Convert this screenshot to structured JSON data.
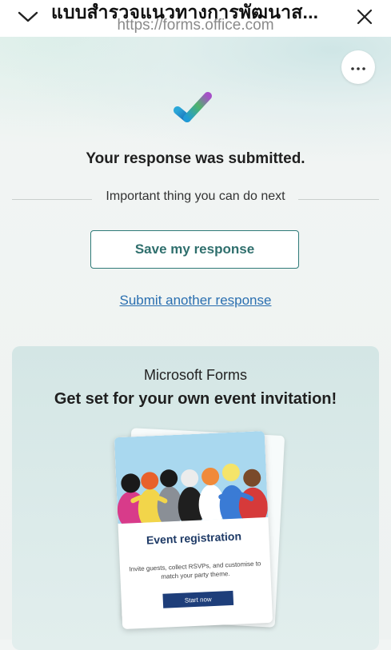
{
  "browser": {
    "title": "แบบสำรวจแนวทางการพัฒนาส...",
    "url": "https://forms.office.com",
    "collapse_icon": "chevron-down-icon",
    "close_icon": "close-icon"
  },
  "main": {
    "more_icon": "more-options-icon",
    "confirmation_text": "Your response was submitted.",
    "next_label": "Important thing you can do next",
    "save_button_label": "Save my response",
    "another_link_label": "Submit another response"
  },
  "promo": {
    "brand": "Microsoft Forms",
    "headline": "Get set for your own event invitation!",
    "card": {
      "title": "Event registration",
      "description": "Invite guests, collect RSVPs, and customise to match your party theme.",
      "button_label": "Start now"
    }
  },
  "colors": {
    "accent": "#2f7a78",
    "link": "#2a6fb0",
    "card_button": "#1e3e7a"
  }
}
